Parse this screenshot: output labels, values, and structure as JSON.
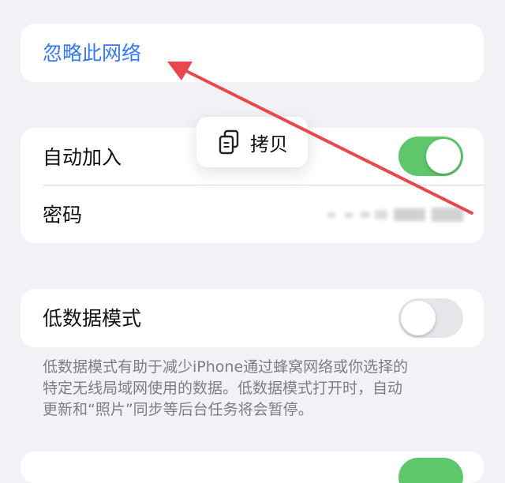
{
  "forget_network": {
    "label": "忽略此网络"
  },
  "auto_join": {
    "label": "自动加入",
    "toggle_on": true,
    "toggle_color": "#5ec76a"
  },
  "password": {
    "label": "密码"
  },
  "copy_popup": {
    "label": "拷贝",
    "icon": "copy-icon"
  },
  "low_data_mode": {
    "label": "低数据模式",
    "toggle_on": false
  },
  "low_data_footnote": "低数据模式有助于减少iPhone通过蜂窝网络或你选择的\n特定无线局域网使用的数据。低数据模式打开时，自动\n更新和“照片”同步等后台任务将会暂停。",
  "colors": {
    "accent": "#3478f6",
    "annotation_arrow": "#e8474c",
    "background": "#f1f1f6"
  }
}
